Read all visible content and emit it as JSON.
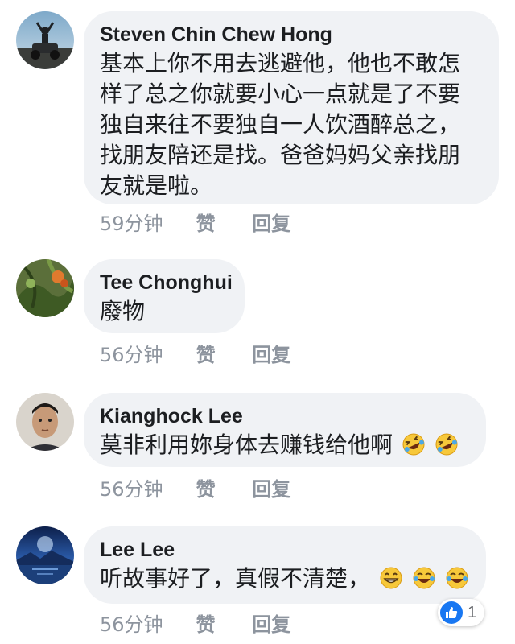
{
  "comments": [
    {
      "author": "Steven Chin Chew Hong",
      "lines": [
        "基本上你不用去逃避他，他也不敢怎",
        "样了总之你就要小心一点就是了不要",
        "独自来往不要独自一人饮酒醉总之，",
        "找朋友陪还是找。爸爸妈妈父亲找朋",
        "友就是啦。"
      ],
      "time": "59分钟",
      "like": "赞",
      "reply": "回复",
      "avatar": "silhouette-person-avatar"
    },
    {
      "author": "Tee Chonghui",
      "lines": [
        "廢物"
      ],
      "time": "56分钟",
      "like": "赞",
      "reply": "回复",
      "avatar": "tropical-plant-avatar"
    },
    {
      "author": "Kianghock Lee",
      "lines": [
        "莫非利用妳身体去赚钱给他啊"
      ],
      "emojis": [
        "rofl-emoji",
        "rofl-emoji"
      ],
      "time": "56分钟",
      "like": "赞",
      "reply": "回复",
      "avatar": "man-face-avatar"
    },
    {
      "author": "Lee Lee",
      "lines": [
        "听故事好了，真假不清楚，"
      ],
      "emojis": [
        "grin-emoji",
        "tears-of-joy-emoji",
        "tears-of-joy-emoji"
      ],
      "time": "56分钟",
      "like": "赞",
      "reply": "回复",
      "avatar": "night-lake-avatar",
      "reactions": {
        "icon": "thumbs-up-icon",
        "count": "1"
      }
    }
  ],
  "colors": {
    "bubble": "#f0f2f5",
    "author_text": "#1c1e21",
    "meta_text": "#8d949e",
    "like_blue": "#1877f2"
  }
}
